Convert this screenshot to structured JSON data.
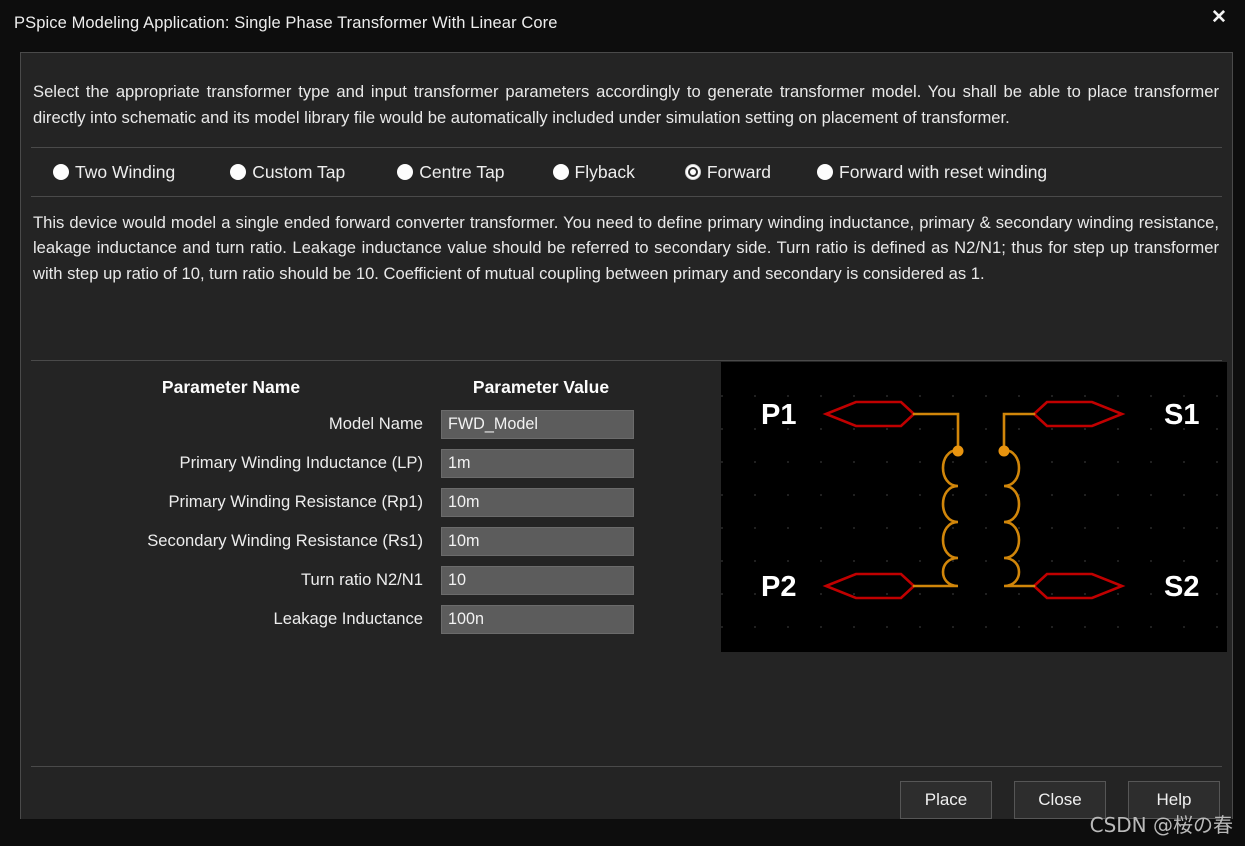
{
  "window": {
    "title": "PSpice Modeling Application: Single Phase Transformer With Linear Core",
    "close_icon": "close-icon",
    "close_glyph": "✕"
  },
  "intro_text": "Select the appropriate transformer type and input transformer parameters accordingly to generate transformer model. You shall be able to place transformer directly into schematic and its model library file would be automatically included under simulation setting on placement of transformer.",
  "transformer_types": {
    "selected": "Forward",
    "options": [
      {
        "label": "Two Winding",
        "selected": false
      },
      {
        "label": "Custom Tap",
        "selected": false
      },
      {
        "label": "Centre Tap",
        "selected": false
      },
      {
        "label": "Flyback",
        "selected": false
      },
      {
        "label": "Forward",
        "selected": true
      },
      {
        "label": "Forward with reset winding",
        "selected": false
      }
    ]
  },
  "type_description": "This device would model a single ended forward converter transformer. You need to define primary winding inductance, primary & secondary winding resistance, leakage inductance and turn ratio. Leakage inductance value should be referred to secondary side. Turn ratio is defined as N2/N1; thus for step up transformer with step up ratio of 10, turn ratio should be 10. Coefficient of mutual coupling between primary and secondary is considered as 1.",
  "parameters": {
    "header_name": "Parameter Name",
    "header_value": "Parameter Value",
    "rows": [
      {
        "label": "Model Name",
        "value": "FWD_Model"
      },
      {
        "label": "Primary Winding Inductance (LP)",
        "value": "1m"
      },
      {
        "label": "Primary Winding Resistance (Rp1)",
        "value": "10m"
      },
      {
        "label": "Secondary Winding Resistance (Rs1)",
        "value": "10m"
      },
      {
        "label": "Turn ratio N2/N1",
        "value": "10"
      },
      {
        "label": "Leakage Inductance",
        "value": "100n"
      }
    ]
  },
  "schematic": {
    "name": "forward-transformer-symbol",
    "pin_labels": {
      "p1": "P1",
      "p2": "P2",
      "s1": "S1",
      "s2": "S2"
    },
    "colors": {
      "background": "#000000",
      "wire": "#d1860a",
      "pin": "#c00000",
      "dot": "#e8940f",
      "grid": "#262626",
      "label": "#ffffff"
    }
  },
  "buttons": {
    "place": "Place",
    "close": "Close",
    "help": "Help"
  },
  "watermark": "CSDN @桜の春",
  "colors": {
    "window_background": "#0d0d0d",
    "panel_background": "#242424",
    "border": "#4a4a4a",
    "input_background": "#5c5c5c",
    "text": "#ededed"
  }
}
